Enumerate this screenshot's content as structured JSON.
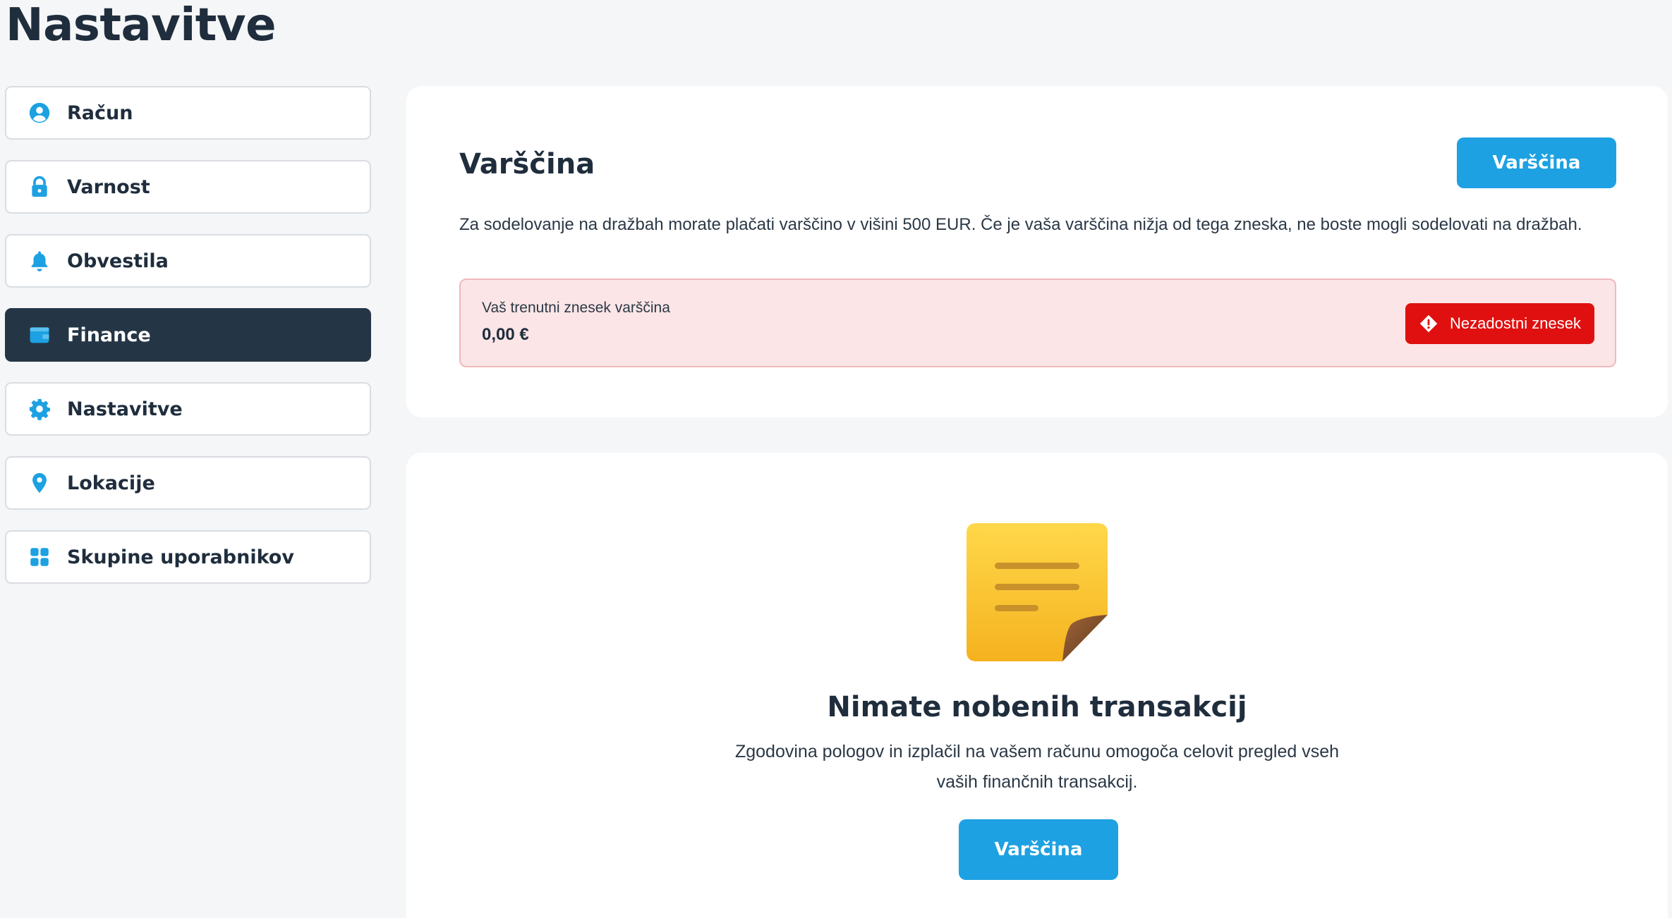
{
  "page": {
    "title": "Nastavitve"
  },
  "sidebar": {
    "items": [
      {
        "label": "Račun",
        "icon": "user-circle-icon"
      },
      {
        "label": "Varnost",
        "icon": "lock-icon"
      },
      {
        "label": "Obvestila",
        "icon": "bell-icon"
      },
      {
        "label": "Finance",
        "icon": "wallet-icon",
        "active": true
      },
      {
        "label": "Nastavitve",
        "icon": "gear-icon"
      },
      {
        "label": "Lokacije",
        "icon": "location-pin-icon"
      },
      {
        "label": "Skupine uporabnikov",
        "icon": "grid-icon"
      }
    ]
  },
  "deposit": {
    "title": "Varščina",
    "button_label": "Varščina",
    "description": "Za sodelovanje na dražbah morate plačati varščino v višini 500 EUR. Če je vaša varščina nižja od tega zneska, ne boste mogli sodelovati na dražbah.",
    "balance_label": "Vaš trenutni znesek varščina",
    "balance_value": "0,00 €",
    "badge_label": "Nezadostni znesek",
    "badge_icon": "warning-diamond-icon"
  },
  "transactions": {
    "empty_icon": "sticky-note-icon",
    "empty_title": "Nimate nobenih transakcij",
    "empty_description": "Zgodovina pologov in izplačil na vašem računu omogoča celovit pregled vseh vaših finančnih transakcij.",
    "button_label": "Varščina"
  },
  "colors": {
    "accent": "#1da1e2",
    "dark": "#243646",
    "danger": "#e01010",
    "danger_bg": "#fbe5e6"
  }
}
